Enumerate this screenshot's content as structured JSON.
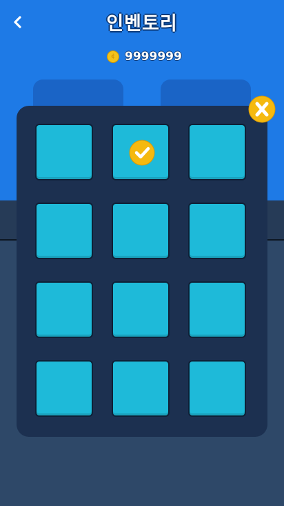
{
  "header": {
    "title": "인벤토리",
    "back_icon": "chevron-left-icon"
  },
  "currency": {
    "icon": "coin-icon",
    "coin_symbol": "¢",
    "amount": "9999999"
  },
  "inventory": {
    "selected_index": 1,
    "slots": [
      {
        "selected": false
      },
      {
        "selected": true
      },
      {
        "selected": false
      },
      {
        "selected": false
      },
      {
        "selected": false
      },
      {
        "selected": false
      },
      {
        "selected": false
      },
      {
        "selected": false
      },
      {
        "selected": false
      },
      {
        "selected": false
      },
      {
        "selected": false
      },
      {
        "selected": false
      }
    ]
  },
  "close_button": {
    "icon": "close-icon"
  },
  "colors": {
    "header_bg": "#1e7ae6",
    "panel_bg": "#1c3050",
    "slot_bg": "#1ebad9",
    "accent": "#f5b90f"
  }
}
